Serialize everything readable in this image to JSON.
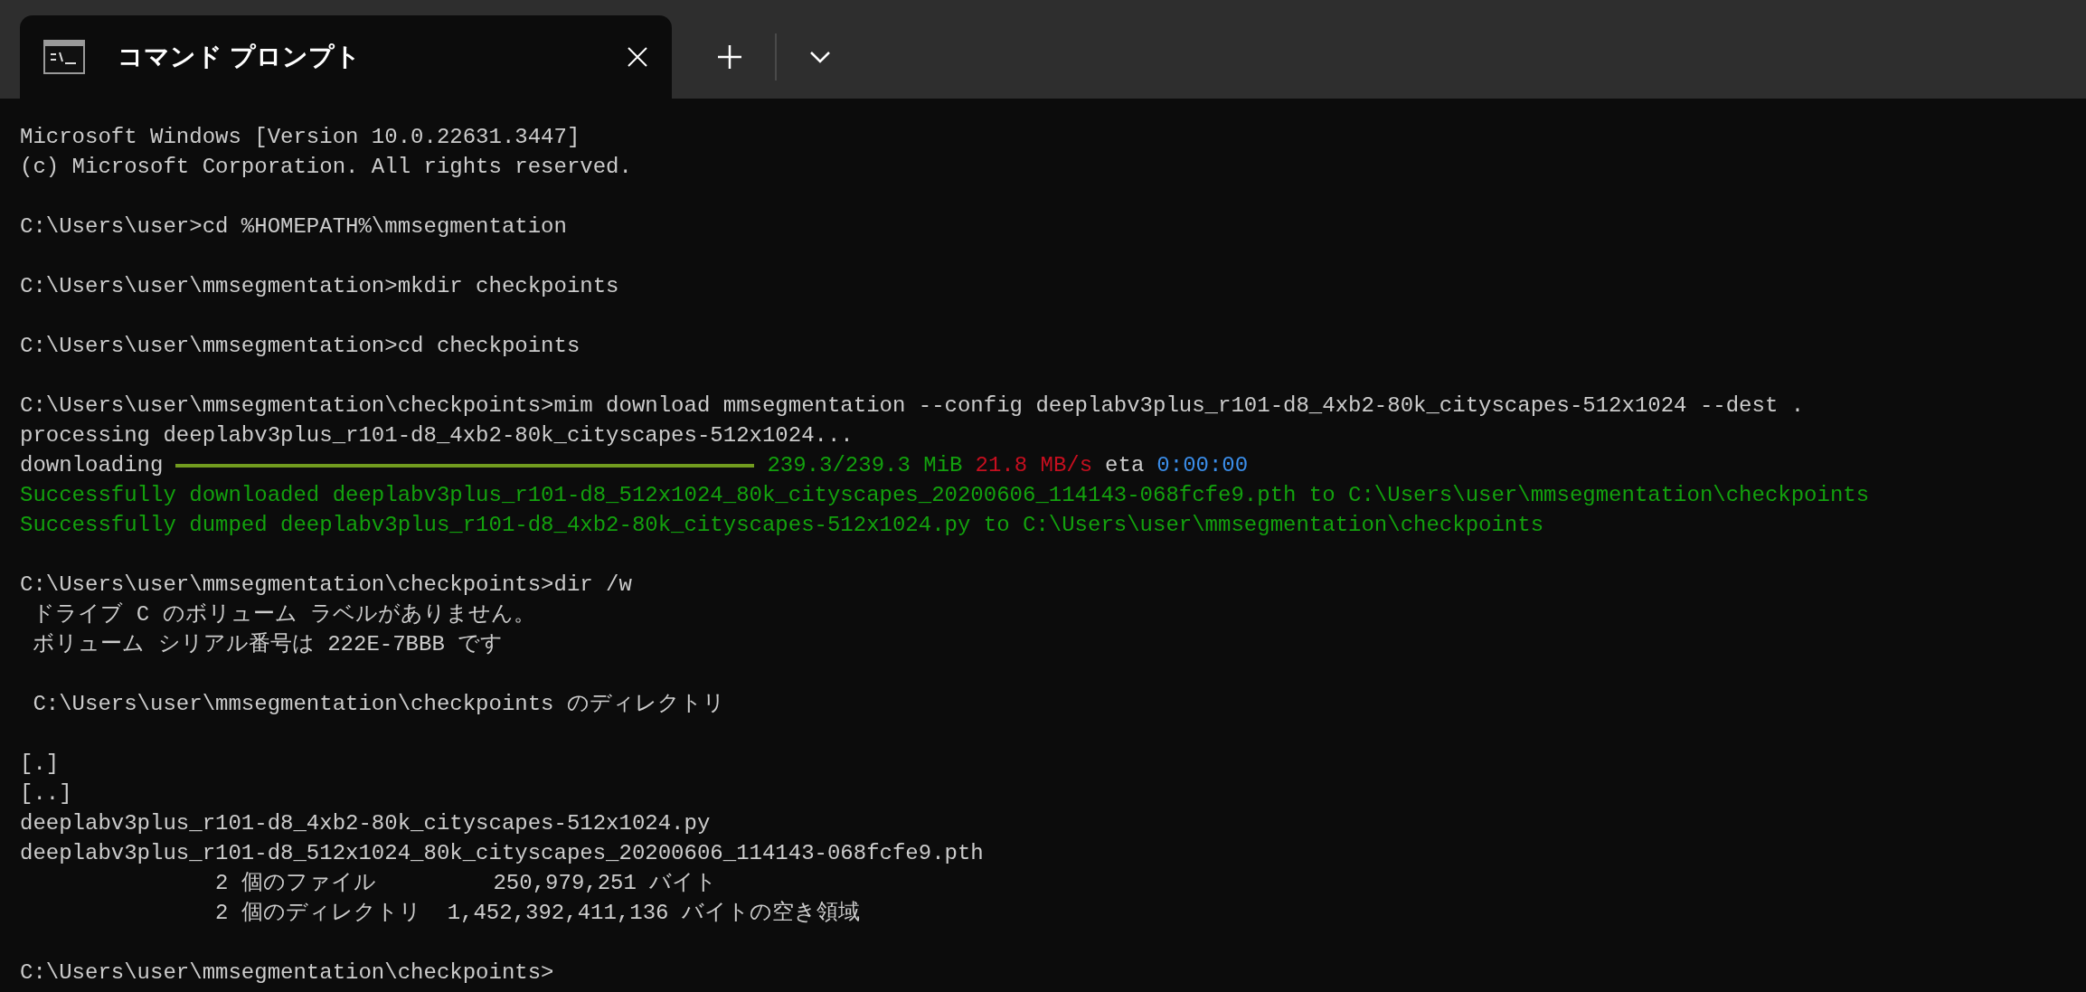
{
  "tab": {
    "title": "コマンド プロンプト",
    "selected": true
  },
  "lines": [
    {
      "kind": "text",
      "segments": [
        {
          "text": "Microsoft Windows [Version 10.0.22631.3447]",
          "color": "#cccccc"
        }
      ]
    },
    {
      "kind": "text",
      "segments": [
        {
          "text": "(c) Microsoft Corporation. All rights reserved.",
          "color": "#cccccc"
        }
      ]
    },
    {
      "kind": "blank"
    },
    {
      "kind": "text",
      "segments": [
        {
          "text": "C:\\Users\\user>cd %HOMEPATH%\\mmsegmentation",
          "color": "#cccccc"
        }
      ]
    },
    {
      "kind": "blank"
    },
    {
      "kind": "text",
      "segments": [
        {
          "text": "C:\\Users\\user\\mmsegmentation>mkdir checkpoints",
          "color": "#cccccc"
        }
      ]
    },
    {
      "kind": "blank"
    },
    {
      "kind": "text",
      "segments": [
        {
          "text": "C:\\Users\\user\\mmsegmentation>cd checkpoints",
          "color": "#cccccc"
        }
      ]
    },
    {
      "kind": "blank"
    },
    {
      "kind": "text",
      "segments": [
        {
          "text": "C:\\Users\\user\\mmsegmentation\\checkpoints>mim download mmsegmentation --config deeplabv3plus_r101-d8_4xb2-80k_cityscapes-512x1024 --dest .",
          "color": "#cccccc"
        }
      ]
    },
    {
      "kind": "text",
      "segments": [
        {
          "text": "processing deeplabv3plus_r101-d8_4xb2-80k_cityscapes-512x1024...",
          "color": "#cccccc"
        }
      ]
    },
    {
      "kind": "progress",
      "label": "downloading",
      "level": 1,
      "segments": [
        {
          "text": "239.3/239.3 MiB",
          "color": "#13a10e"
        },
        {
          "text": "21.8 MB/s",
          "color": "#c50f1f"
        },
        {
          "text": "eta",
          "color": "#cccccc"
        },
        {
          "text": "0:00:00",
          "color": "#3b8eea"
        }
      ]
    },
    {
      "kind": "text",
      "segments": [
        {
          "text": "Successfully downloaded deeplabv3plus_r101-d8_512x1024_80k_cityscapes_20200606_114143-068fcfe9.pth to C:\\Users\\user\\mmsegmentation\\checkpoints",
          "color": "#13a10e"
        }
      ]
    },
    {
      "kind": "text",
      "segments": [
        {
          "text": "Successfully dumped deeplabv3plus_r101-d8_4xb2-80k_cityscapes-512x1024.py to C:\\Users\\user\\mmsegmentation\\checkpoints",
          "color": "#13a10e"
        }
      ]
    },
    {
      "kind": "blank"
    },
    {
      "kind": "text",
      "segments": [
        {
          "text": "C:\\Users\\user\\mmsegmentation\\checkpoints>dir /w",
          "color": "#cccccc"
        }
      ]
    },
    {
      "kind": "text",
      "segments": [
        {
          "text": " ドライブ C のボリューム ラベルがありません。",
          "color": "#cccccc"
        }
      ]
    },
    {
      "kind": "text",
      "segments": [
        {
          "text": " ボリューム シリアル番号は 222E-7BBB です",
          "color": "#cccccc"
        }
      ]
    },
    {
      "kind": "blank"
    },
    {
      "kind": "text",
      "segments": [
        {
          "text": " C:\\Users\\user\\mmsegmentation\\checkpoints のディレクトリ",
          "color": "#cccccc"
        }
      ]
    },
    {
      "kind": "blank"
    },
    {
      "kind": "text",
      "segments": [
        {
          "text": "[.]",
          "color": "#cccccc"
        }
      ]
    },
    {
      "kind": "text",
      "segments": [
        {
          "text": "[..]",
          "color": "#cccccc"
        }
      ]
    },
    {
      "kind": "text",
      "segments": [
        {
          "text": "deeplabv3plus_r101-d8_4xb2-80k_cityscapes-512x1024.py",
          "color": "#cccccc"
        }
      ]
    },
    {
      "kind": "text",
      "segments": [
        {
          "text": "deeplabv3plus_r101-d8_512x1024_80k_cityscapes_20200606_114143-068fcfe9.pth",
          "color": "#cccccc"
        }
      ]
    },
    {
      "kind": "text",
      "segments": [
        {
          "text": "               2 個のファイル         250,979,251 バイト",
          "color": "#cccccc"
        }
      ]
    },
    {
      "kind": "text",
      "segments": [
        {
          "text": "               2 個のディレクトリ  1,452,392,411,136 バイトの空き領域",
          "color": "#cccccc"
        }
      ]
    },
    {
      "kind": "blank"
    },
    {
      "kind": "text",
      "segments": [
        {
          "text": "C:\\Users\\user\\mmsegmentation\\checkpoints>",
          "color": "#cccccc"
        }
      ]
    }
  ]
}
